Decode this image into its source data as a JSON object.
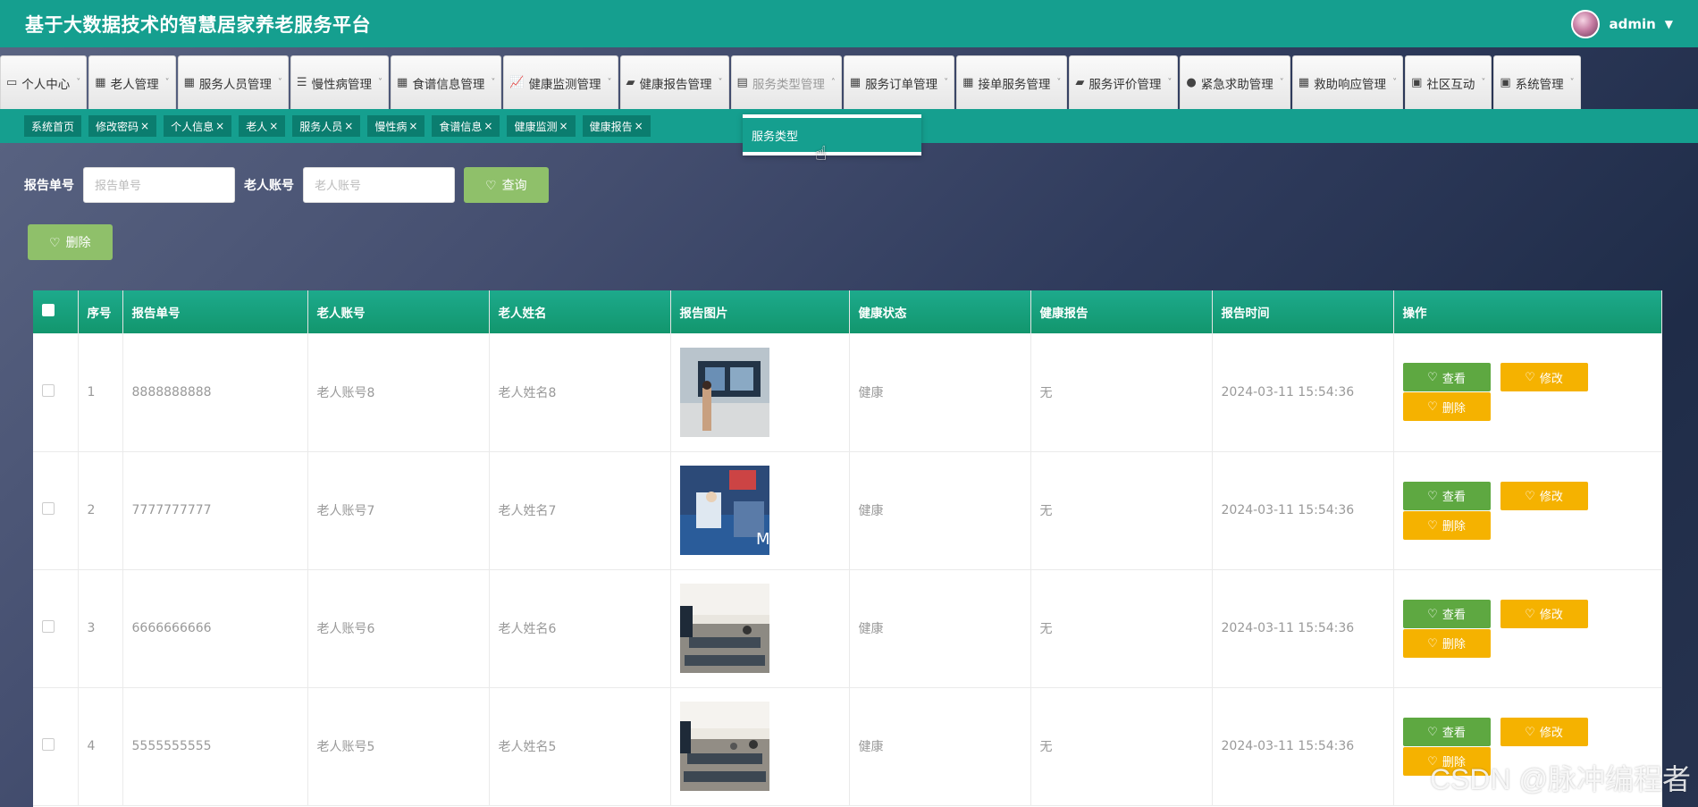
{
  "app": {
    "title": "基于大数据技术的智慧居家养老服务平台",
    "username": "admin"
  },
  "nav": [
    {
      "label": "个人中心",
      "icon": "layout-icon"
    },
    {
      "label": "老人管理",
      "icon": "grid-icon"
    },
    {
      "label": "服务人员管理",
      "icon": "grid-icon"
    },
    {
      "label": "慢性病管理",
      "icon": "sliders-icon"
    },
    {
      "label": "食谱信息管理",
      "icon": "grid-icon"
    },
    {
      "label": "健康监测管理",
      "icon": "chart-icon"
    },
    {
      "label": "健康报告管理",
      "icon": "briefcase-icon"
    },
    {
      "label": "服务类型管理",
      "icon": "clipboard-icon"
    },
    {
      "label": "服务订单管理",
      "icon": "grid-icon"
    },
    {
      "label": "接单服务管理",
      "icon": "grid-icon"
    },
    {
      "label": "服务评价管理",
      "icon": "briefcase-icon"
    },
    {
      "label": "紧急求助管理",
      "icon": "user-icon"
    },
    {
      "label": "救助响应管理",
      "icon": "grid-icon"
    },
    {
      "label": "社区互动",
      "icon": "clipboard-x-icon"
    },
    {
      "label": "系统管理",
      "icon": "clipboard-check-icon"
    }
  ],
  "tags": [
    "系统首页",
    "修改密码",
    "个人信息",
    "老人",
    "服务人员",
    "慢性病",
    "食谱信息",
    "健康监测",
    "健康报告"
  ],
  "dropdown": {
    "item": "服务类型"
  },
  "search": {
    "report_no_label": "报告单号",
    "report_no_placeholder": "报告单号",
    "account_label": "老人账号",
    "account_placeholder": "老人账号",
    "query_label": "查询",
    "delete_label": "删除"
  },
  "table": {
    "headers": [
      "序号",
      "报告单号",
      "老人账号",
      "老人姓名",
      "报告图片",
      "健康状态",
      "健康报告",
      "报告时间",
      "操作"
    ],
    "rows": [
      {
        "index": "1",
        "report_no": "8888888888",
        "account": "老人账号8",
        "name": "老人姓名8",
        "status": "健康",
        "report": "无",
        "time": "2024-03-11 15:54:36"
      },
      {
        "index": "2",
        "report_no": "7777777777",
        "account": "老人账号7",
        "name": "老人姓名7",
        "status": "健康",
        "report": "无",
        "time": "2024-03-11 15:54:36"
      },
      {
        "index": "3",
        "report_no": "6666666666",
        "account": "老人账号6",
        "name": "老人姓名6",
        "status": "健康",
        "report": "无",
        "time": "2024-03-11 15:54:36"
      },
      {
        "index": "4",
        "report_no": "5555555555",
        "account": "老人账号5",
        "name": "老人姓名5",
        "status": "健康",
        "report": "无",
        "time": "2024-03-11 15:54:36"
      }
    ],
    "actions": {
      "view": "查看",
      "edit": "修改",
      "delete": "删除"
    }
  },
  "watermark": "CSDN @脉冲编程者",
  "colors": {
    "primary": "#159f8f",
    "dark_primary": "#0b7d6f",
    "view_green": "#5ea841",
    "warn": "#f5b200",
    "query_green": "#8fc06a"
  }
}
